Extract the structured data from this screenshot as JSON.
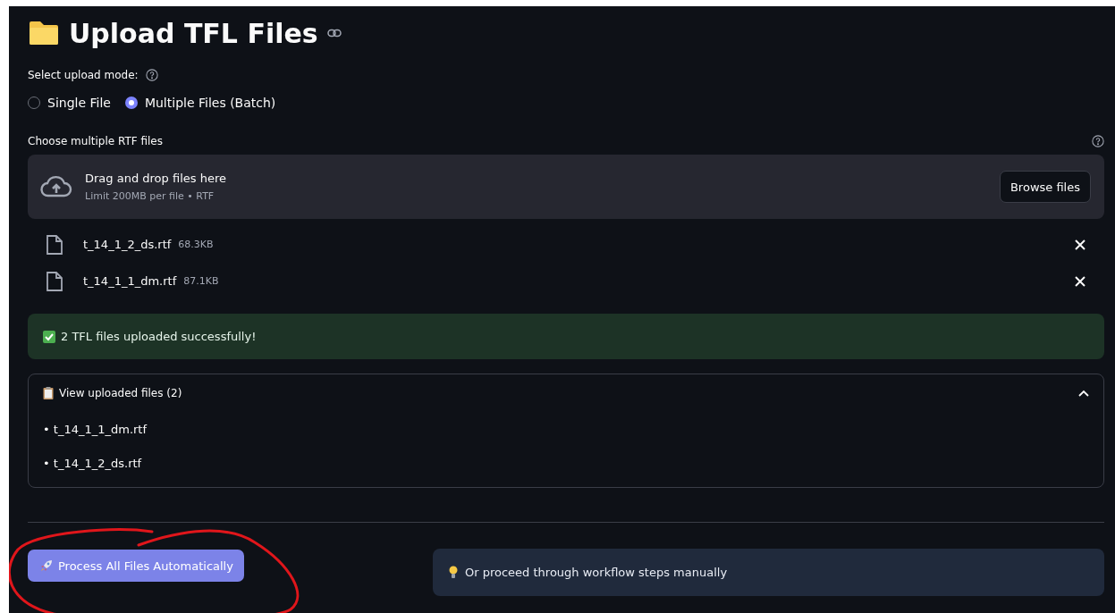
{
  "title": "Upload TFL Files",
  "upload_mode": {
    "label": "Select upload mode:",
    "options": [
      {
        "label": "Single File",
        "selected": false
      },
      {
        "label": "Multiple Files (Batch)",
        "selected": true
      }
    ]
  },
  "uploader": {
    "label": "Choose multiple RTF files",
    "drop_text": "Drag and drop files here",
    "limit_text": "Limit 200MB per file • RTF",
    "browse_button": "Browse files"
  },
  "files": [
    {
      "name": "t_14_1_2_ds.rtf",
      "size": "68.3KB"
    },
    {
      "name": "t_14_1_1_dm.rtf",
      "size": "87.1KB"
    }
  ],
  "success_message": "2 TFL files uploaded successfully!",
  "expander": {
    "title": "View uploaded files (2)",
    "expanded": true,
    "items": [
      "• t_14_1_1_dm.rtf",
      "• t_14_1_2_ds.rtf"
    ]
  },
  "process_button": "Process All Files Automatically",
  "info_message": "Or proceed through workflow steps manually"
}
